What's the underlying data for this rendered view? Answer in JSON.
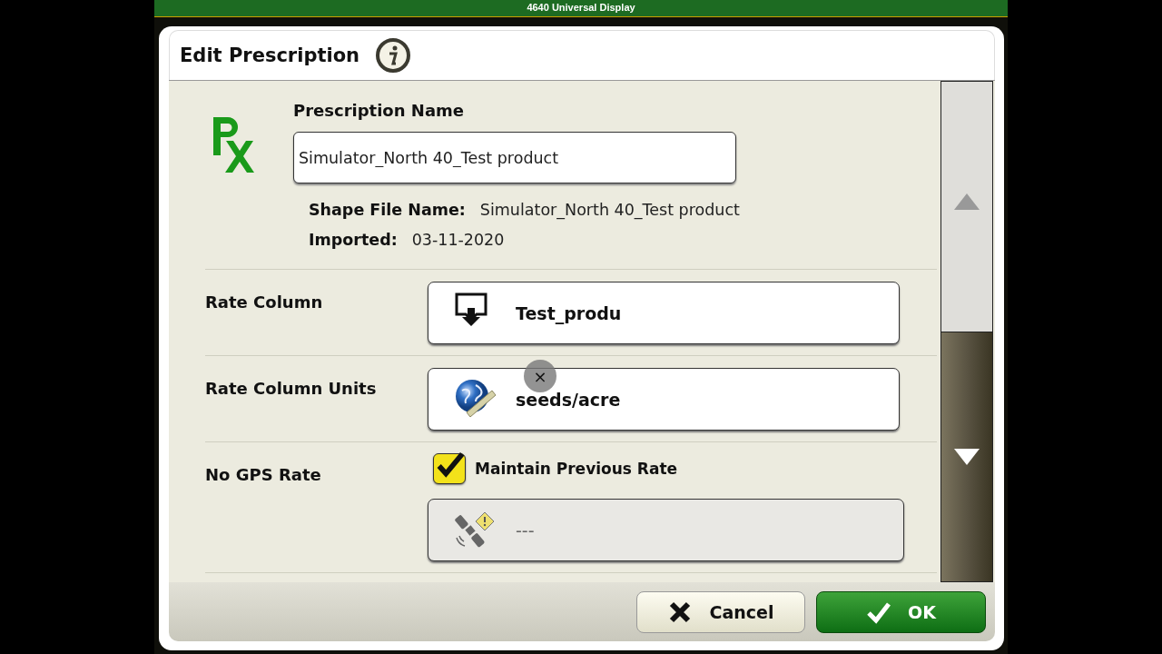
{
  "display": {
    "title": "4640 Universal Display"
  },
  "dialog": {
    "title": "Edit Prescription"
  },
  "prescription_name": {
    "label": "Prescription Name",
    "value": "Simulator_North 40_Test product"
  },
  "details": [
    {
      "label": "Shape File Name:",
      "value": "Simulator_North 40_Test product"
    },
    {
      "label": "Imported:",
      "value": "03-11-2020"
    }
  ],
  "rows": [
    {
      "label": "Rate Column",
      "kind": "select",
      "value": "Test_produ"
    },
    {
      "label": "Rate Column Units",
      "kind": "select",
      "value": "seeds/acre"
    },
    {
      "label": "No GPS Rate",
      "kind": "checkbox_field",
      "checkbox": {
        "label": "Maintain Previous Rate",
        "checked": true
      },
      "field": {
        "value": "---",
        "disabled": true
      }
    }
  ],
  "scroll": {
    "up_enabled": false,
    "down_enabled": true
  },
  "touch_marker": {
    "glyph": "×"
  },
  "buttons": [
    {
      "kind": "cancel",
      "label": "Cancel"
    },
    {
      "kind": "ok",
      "label": "OK"
    }
  ]
}
